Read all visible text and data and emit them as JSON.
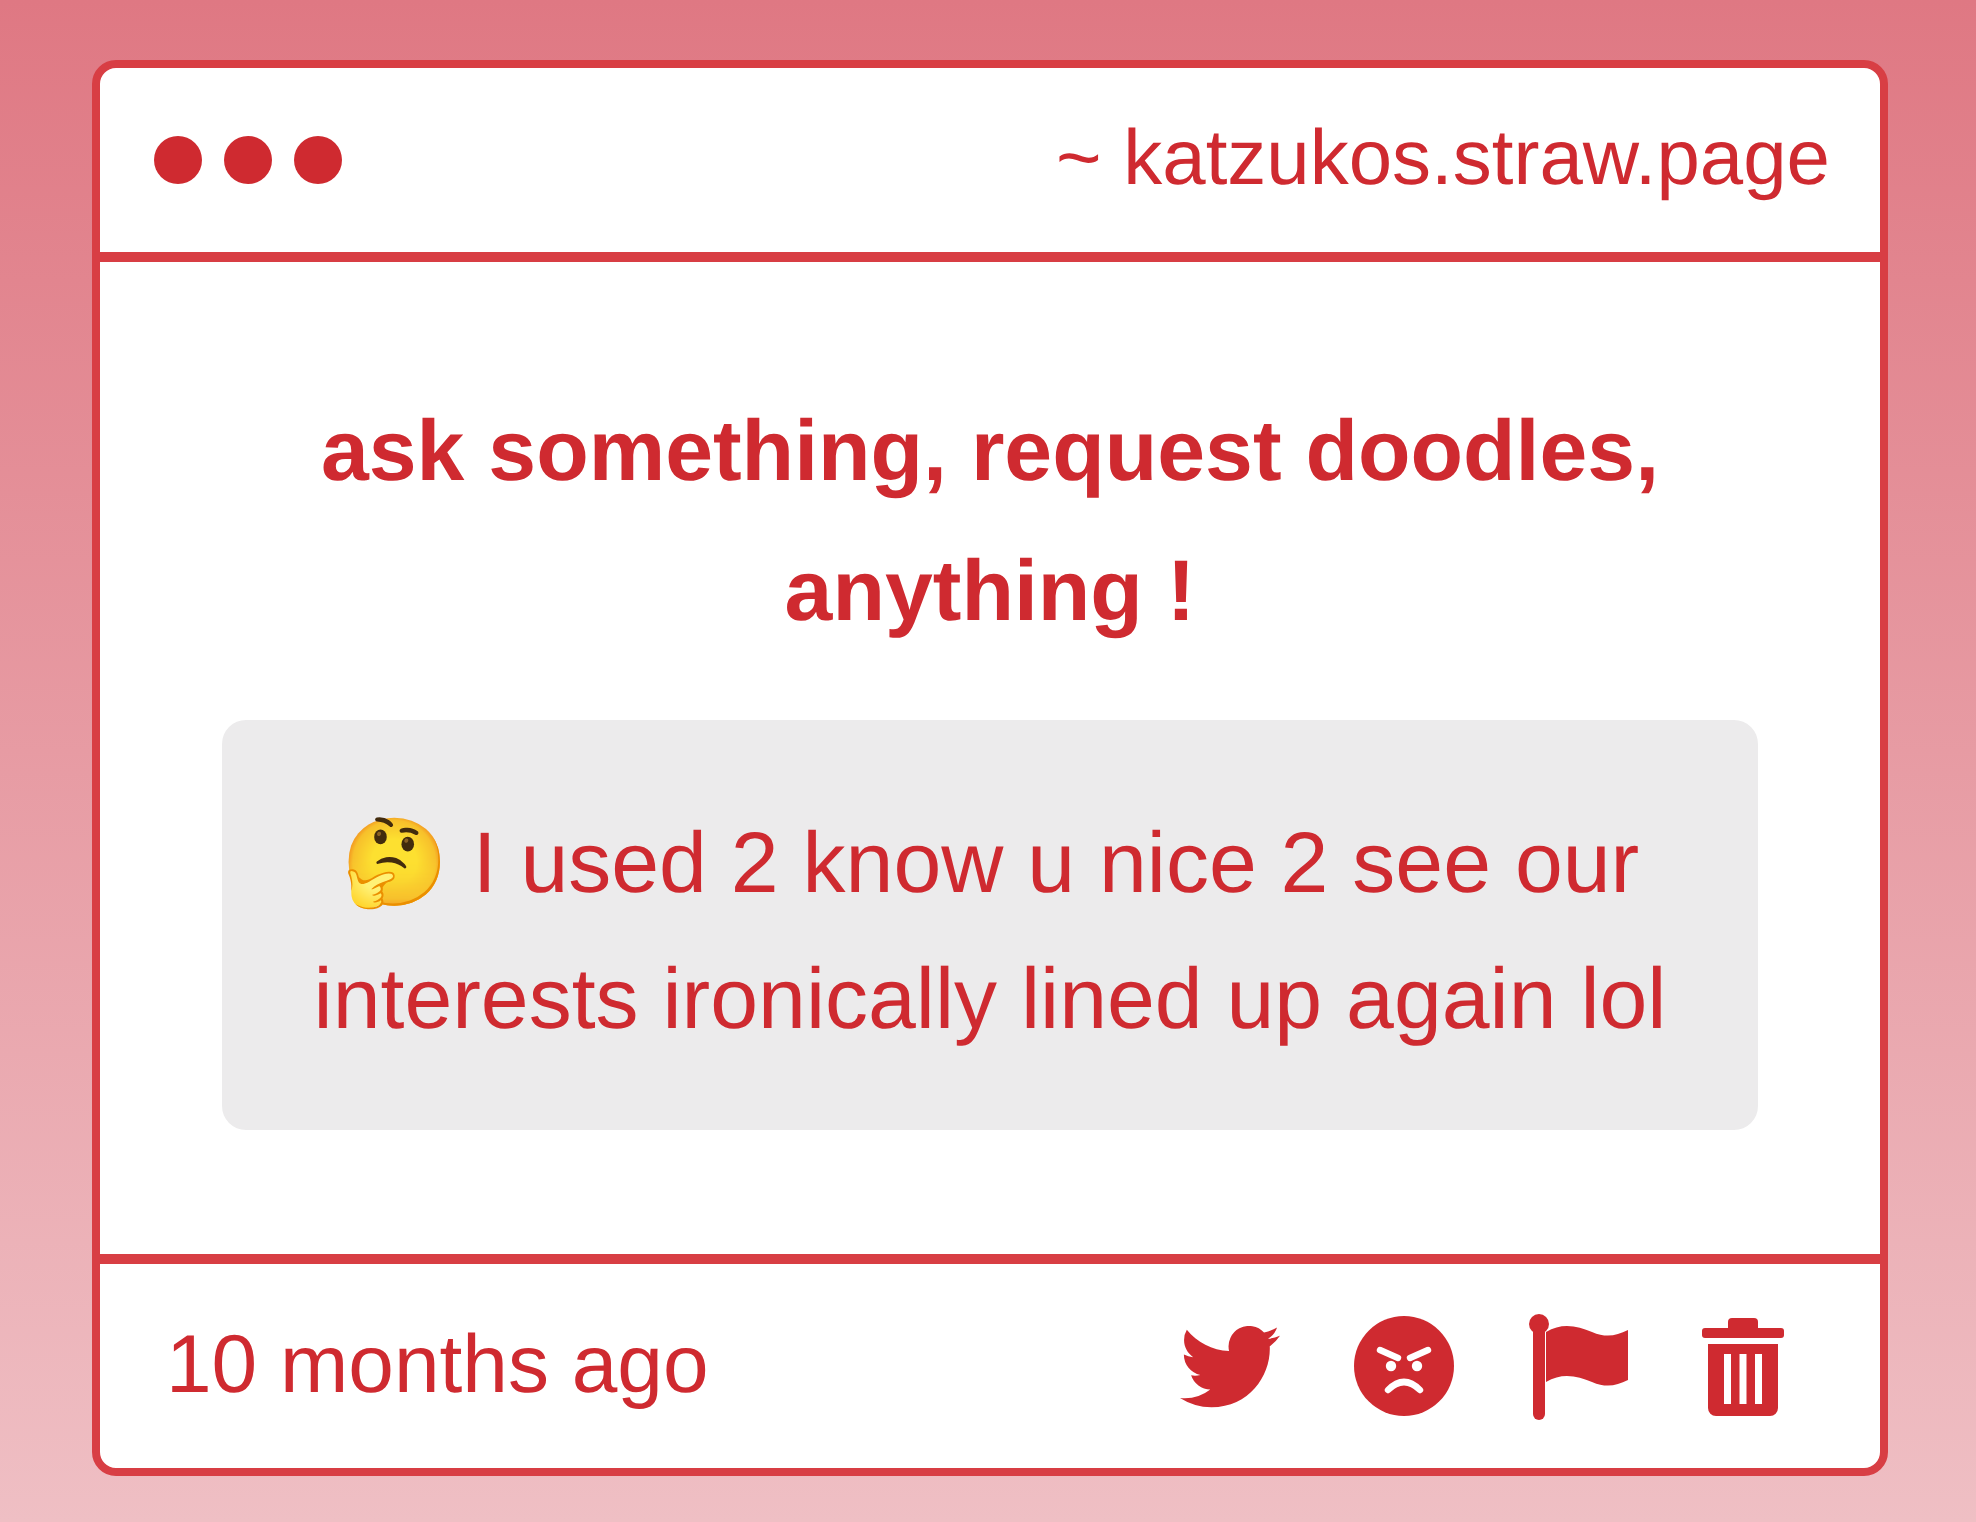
{
  "window": {
    "address": "~ katzukos.straw.page"
  },
  "prompt": "ask something, request doodles, anything !",
  "question": {
    "text": "🤔 I used 2 know u nice 2 see our interests ironically lined up again lol"
  },
  "footer": {
    "time": "10 months ago",
    "actions": [
      {
        "kind": "bird"
      },
      {
        "kind": "angry"
      },
      {
        "kind": "flag"
      },
      {
        "kind": "trash"
      }
    ]
  }
}
